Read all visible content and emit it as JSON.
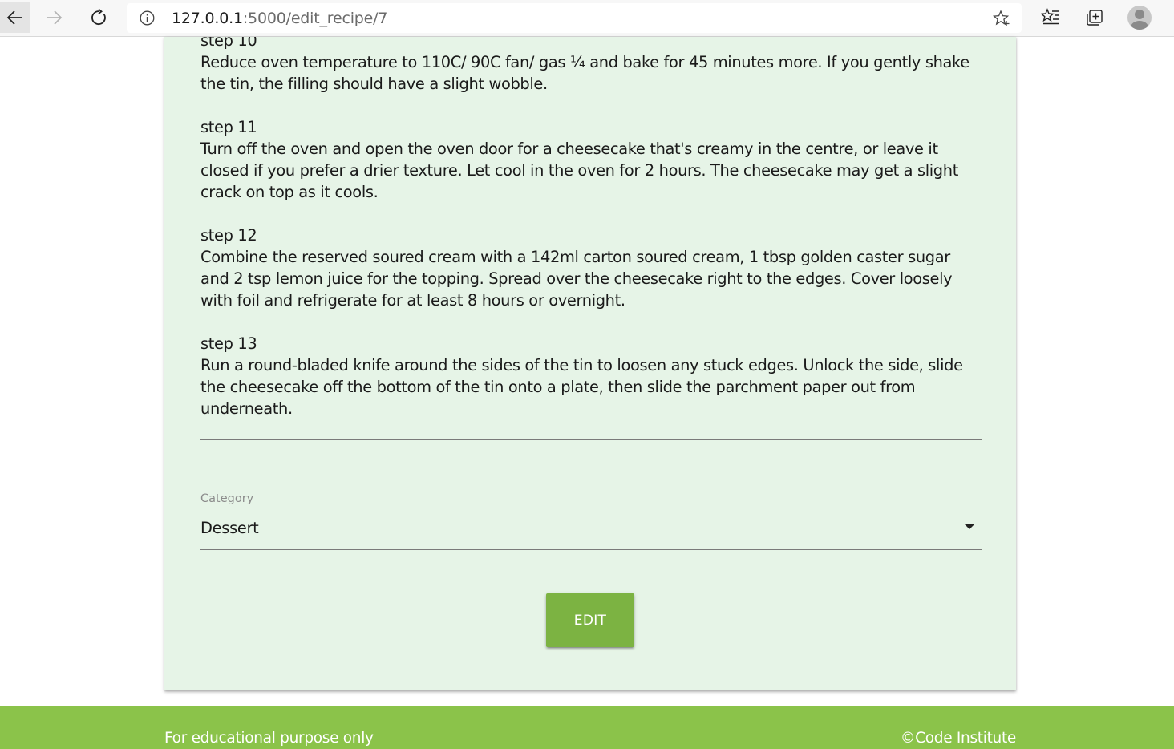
{
  "browser": {
    "url_host": "127.0.0.1",
    "url_path": ":5000/edit_recipe/7",
    "icons": {
      "back": "back-arrow-icon",
      "forward": "forward-arrow-icon",
      "reload": "reload-icon",
      "info": "info-icon",
      "favorite": "star-add-icon",
      "favorites": "favorites-icon",
      "collections": "collections-icon",
      "profile": "profile-avatar-icon"
    }
  },
  "form": {
    "steps": [
      {
        "label": "step 10",
        "text": "Reduce oven temperature to 110C/ 90C fan/ gas ¼ and bake for 45 minutes more. If you gently shake the tin, the filling should have a slight wobble."
      },
      {
        "label": "step 11",
        "text": "Turn off the oven and open the oven door for a cheesecake that's creamy in the centre, or leave it closed if you prefer a drier texture. Let cool in the oven for 2 hours. The cheesecake may get a slight crack on top as it cools."
      },
      {
        "label": "step 12",
        "text": "Combine the reserved soured cream with a 142ml carton soured cream, 1 tbsp golden caster sugar and 2 tsp lemon juice for the topping. Spread over the cheesecake right to the edges. Cover loosely with foil and refrigerate for at least 8 hours or overnight."
      },
      {
        "label": "step 13",
        "text": "Run a round-bladed knife around the sides of the tin to loosen any stuck edges. Unlock the side, slide the cheesecake off the bottom of the tin onto a plate, then slide the parchment paper out from underneath."
      }
    ],
    "category_label": "Category",
    "category_value": "Dessert",
    "submit_label": "EDIT"
  },
  "footer": {
    "left_text": "For educational purpose only",
    "right_text": "©Code Institute"
  },
  "colors": {
    "card_bg": "#e6f4e7",
    "button": "#7cb342",
    "footer": "#8bc34a"
  }
}
